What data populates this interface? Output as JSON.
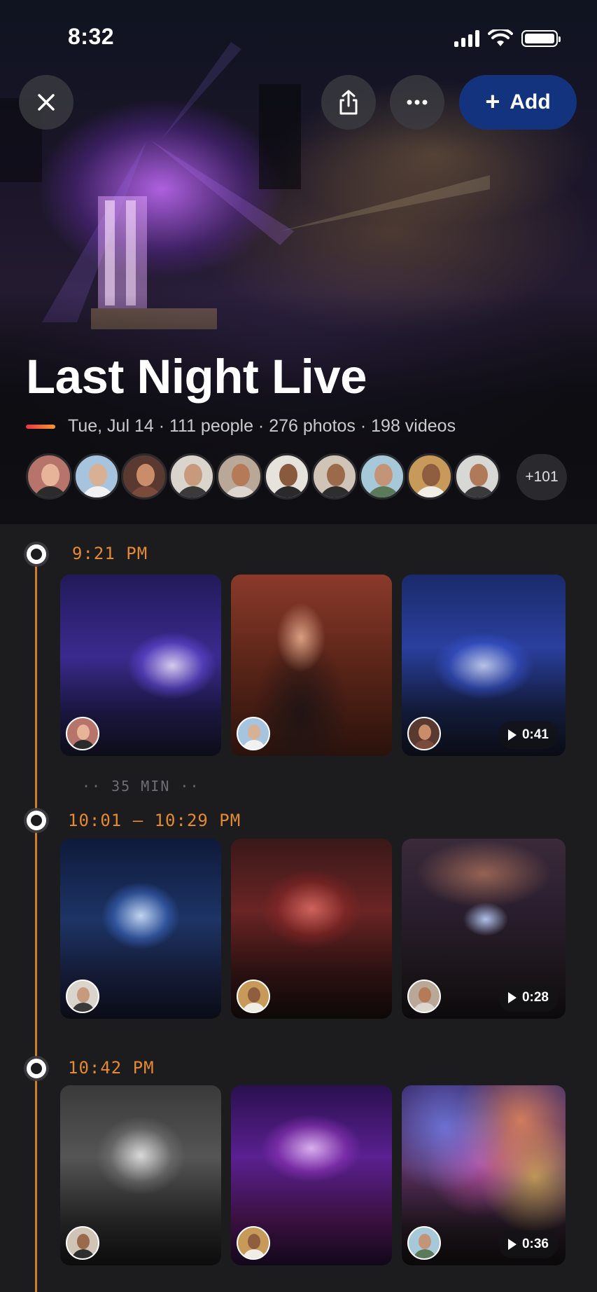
{
  "status_bar": {
    "time": "8:32"
  },
  "header": {
    "add_label": "Add"
  },
  "album": {
    "title": "Last Night Live",
    "meta": "Tue, Jul 14 · 111 people · 276 photos · 198 videos",
    "more_people": "+101"
  },
  "timeline": [
    {
      "time": "9:21 PM"
    },
    {
      "gap": "·· 35 MIN ··"
    },
    {
      "time": "10:01 – 10:29 PM"
    },
    {
      "time": "10:42 PM"
    }
  ],
  "videos": {
    "group1": {
      "duration": "0:41"
    },
    "group2": {
      "duration": "0:28"
    },
    "group3": {
      "duration": "0:36"
    }
  },
  "colors": {
    "accent": "#e58a30",
    "add_button": "#14337f",
    "background": "#1c1c1e"
  },
  "icons": [
    "close-icon",
    "share-icon",
    "more-icon",
    "plus-icon",
    "play-icon",
    "signal-icon",
    "wifi-icon",
    "battery-icon"
  ]
}
